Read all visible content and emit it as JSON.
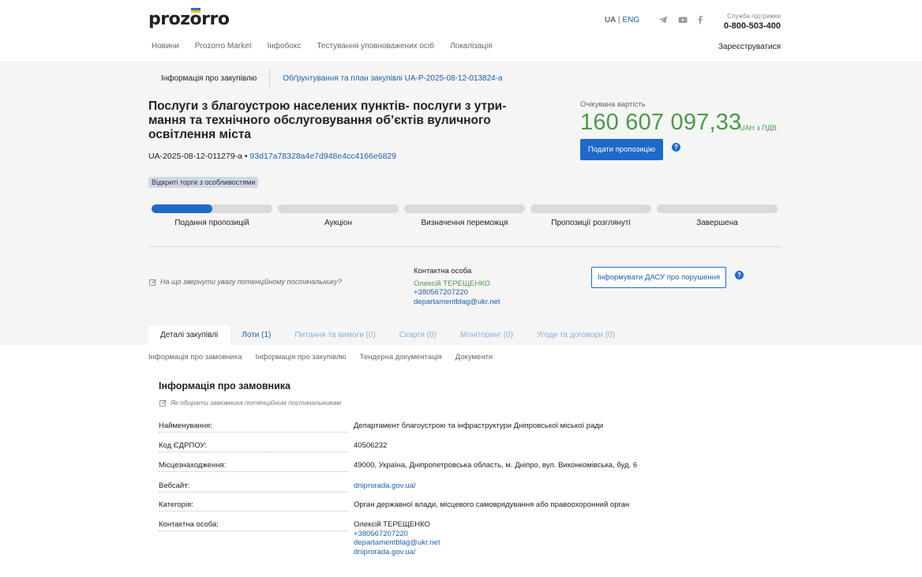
{
  "header": {
    "logo": "prozorro",
    "lang_ua": "UA",
    "lang_sep": "|",
    "lang_en": "ENG",
    "social": [
      "telegram-icon",
      "youtube-icon",
      "facebook-icon"
    ],
    "support_title": "Служба підтримки",
    "support_phone": "0-800-503-400",
    "nav": [
      "Новини",
      "Prozorro Market",
      "Інфобокс",
      "Тестування уповноважених осіб",
      "Локалізація"
    ],
    "register": "Зареєструватися"
  },
  "crumbs": {
    "info": "Інформація про закупівлю",
    "plan": "Обґрунтування та план закупівлі UA-P-2025-08-12-013824-a"
  },
  "tender": {
    "title": "Послуги з благоустрою населених пунктів- послуги з утри-мання та технічного обслуговування об’єктів вуличного освітлення міста",
    "id": "UA-2025-08-12-011279-a",
    "bullet": "•",
    "hash": "93d17a78328a4e7d948e4cc4166e6829",
    "badge": "Відкриті торги з особливостями",
    "value_label": "Очікувана вартість",
    "value": "160 607 097,33",
    "value_unit": "UAH з ПДВ",
    "submit": "Подати пропозицію",
    "help": "?"
  },
  "stages": [
    {
      "label": "Подання пропозицій",
      "progress": 0.5
    },
    {
      "label": "Аукціон",
      "progress": 0
    },
    {
      "label": "Визначення переможця",
      "progress": 0
    },
    {
      "label": "Пропозиції розглянуті",
      "progress": 0
    },
    {
      "label": "Завершена",
      "progress": 0
    }
  ],
  "attention": "На що звернути увагу потенційному постачальнику?",
  "contact": {
    "heading": "Контактна особа",
    "name": "Олексій ТЕРЕЩЕНКО",
    "phone": "+380567207220",
    "email": "departamentblag@ukr.net"
  },
  "dasu_button": "Інформувати ДАСУ про порушення",
  "tabs": [
    "Деталі закупівлі",
    "Лоти (1)",
    "Питання та вимоги (0)",
    "Скарги (0)",
    "Моніторинг (0)",
    "Угоди та договори (0)"
  ],
  "subnav": [
    "Інформація про замовника",
    "Інформація про закупівлю",
    "Тендерна документація",
    "Документи"
  ],
  "customer": {
    "title": "Інформація про замовника",
    "how": "Як обирати замовника потенційним постачальникам",
    "rows": [
      {
        "key": "Найменування:",
        "value": "Департамент благоустрою та інфраструктури Дніпровської міської ради"
      },
      {
        "key": "Код ЄДРПОУ:",
        "value": "40506232"
      },
      {
        "key": "Місцезнаходження:",
        "value": "49000, Україна, Дніпропетровська область, м. Дніпро, вул. Виконкомівська, буд. 6"
      },
      {
        "key": "Вебсайт:",
        "value": "dniprorada.gov.ua/"
      },
      {
        "key": "Категорія:",
        "value": "Орган державної влади, місцевого самоврядування або правоохоронний орган"
      },
      {
        "key": "Контактна особа:",
        "value": "Олексій ТЕРЕЩЕНКО",
        "links": [
          "+380567207220",
          "departamentblag@ukr.net",
          "dniprorada.gov.ua/"
        ]
      }
    ]
  },
  "colors": {
    "accent": "#1f6ac9",
    "value_green": "#4e9a48",
    "band": "#f5f5f5"
  }
}
